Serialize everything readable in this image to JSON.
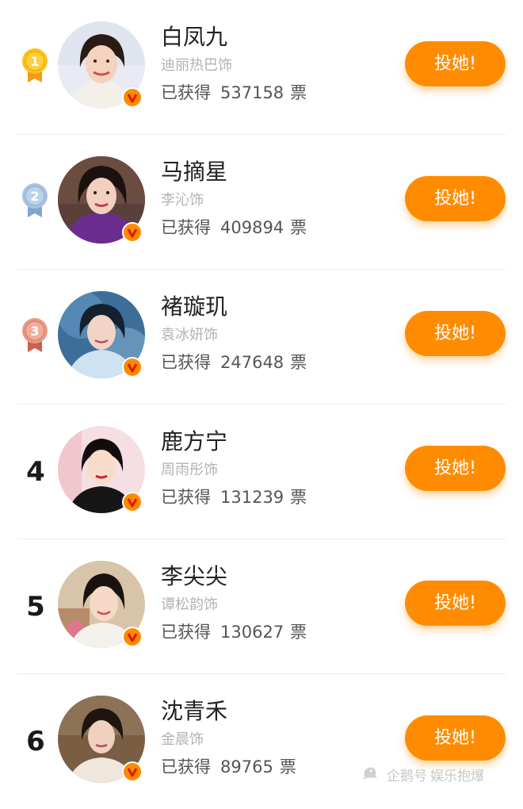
{
  "colors": {
    "accent": "#ff8c00",
    "gold": "#ffc21a",
    "silver": "#a9c3de",
    "bronze": "#e89a86"
  },
  "ranking": [
    {
      "rank": "1",
      "medal": "gold",
      "name": "白凤九",
      "actor": "迪丽热巴饰",
      "votes_prefix": "已获得",
      "votes": "537158",
      "votes_suffix": "票",
      "button": "投她!"
    },
    {
      "rank": "2",
      "medal": "silver",
      "name": "马摘星",
      "actor": "李沁饰",
      "votes_prefix": "已获得",
      "votes": "409894",
      "votes_suffix": "票",
      "button": "投她!"
    },
    {
      "rank": "3",
      "medal": "bronze",
      "name": "褚璇玑",
      "actor": "袁冰妍饰",
      "votes_prefix": "已获得",
      "votes": "247648",
      "votes_suffix": "票",
      "button": "投她!"
    },
    {
      "rank": "4",
      "medal": "",
      "name": "鹿方宁",
      "actor": "周雨彤饰",
      "votes_prefix": "已获得",
      "votes": "131239",
      "votes_suffix": "票",
      "button": "投她!"
    },
    {
      "rank": "5",
      "medal": "",
      "name": "李尖尖",
      "actor": "谭松韵饰",
      "votes_prefix": "已获得",
      "votes": "130627",
      "votes_suffix": "票",
      "button": "投她!"
    },
    {
      "rank": "6",
      "medal": "",
      "name": "沈青禾",
      "actor": "金晨饰",
      "votes_prefix": "已获得",
      "votes": "89765",
      "votes_suffix": "票",
      "button": "投她!"
    }
  ],
  "watermark": {
    "icon": "penguin-logo-icon",
    "brand": "企鹅号",
    "channel": "娱乐抱爆"
  }
}
